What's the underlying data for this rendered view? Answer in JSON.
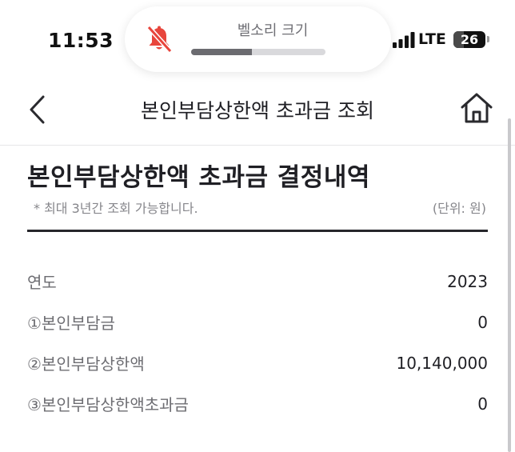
{
  "status_bar": {
    "time": "11:53",
    "network": "LTE",
    "battery": "26"
  },
  "notification": {
    "label": "벨소리 크기",
    "icon": "bell-slash-icon",
    "volume_level": 0.45
  },
  "nav": {
    "title": "본인부담상한액 초과금 조회",
    "back_icon": "chevron-left-icon",
    "home_icon": "home-icon"
  },
  "section": {
    "title": "본인부담상한액 초과금 결정내역",
    "note": "* 최대 3년간 조회 가능합니다.",
    "unit": "(단위: 원)"
  },
  "rows": [
    {
      "label": "연도",
      "value": "2023"
    },
    {
      "label": "①본인부담금",
      "value": "0"
    },
    {
      "label": "②본인부담상한액",
      "value": "10,140,000"
    },
    {
      "label": "③본인부담상한액초과금",
      "value": "0"
    }
  ],
  "colors": {
    "accent_red": "#e8453c",
    "text_dark": "#1f1f24",
    "text_gray": "#6d6d72"
  }
}
